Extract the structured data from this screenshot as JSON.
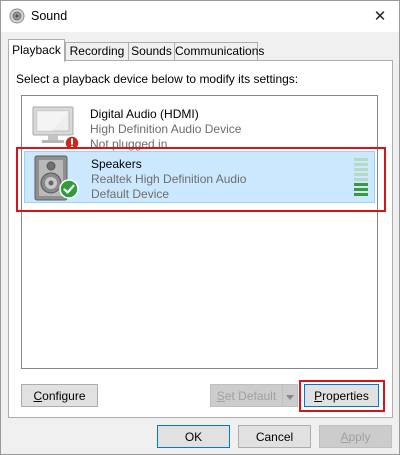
{
  "window": {
    "title": "Sound",
    "close_glyph": "✕"
  },
  "tabs": [
    {
      "label": "Playback",
      "active": true
    },
    {
      "label": "Recording",
      "active": false
    },
    {
      "label": "Sounds",
      "active": false
    },
    {
      "label": "Communications",
      "active": false
    }
  ],
  "playback": {
    "instruction": "Select a playback device below to modify its settings:",
    "devices": [
      {
        "name": "Digital Audio (HDMI)",
        "line2": "High Definition Audio Device",
        "line3": "Not plugged in",
        "icon": "monitor-icon",
        "status_icon": "unplugged-status-icon",
        "selected": false
      },
      {
        "name": "Speakers",
        "line2": "Realtek High Definition Audio",
        "line3": "Default Device",
        "icon": "speaker-icon",
        "status_icon": "default-check-icon",
        "selected": true,
        "level_segments_lit": 3,
        "level_segments_total": 8
      }
    ]
  },
  "buttons": {
    "configure_access": "C",
    "configure_rest": "onfigure",
    "set_default_access": "S",
    "set_default_rest": "et Default",
    "properties_access": "P",
    "properties_rest": "roperties",
    "ok": "OK",
    "cancel": "Cancel",
    "apply_access": "A",
    "apply_rest": "pply"
  },
  "colors": {
    "selection_bg": "#cce8ff",
    "selection_border": "#99d1ff",
    "highlight_red": "#d7141a",
    "meter_on": "#3b9a3b",
    "focus_blue": "#0078d7"
  }
}
